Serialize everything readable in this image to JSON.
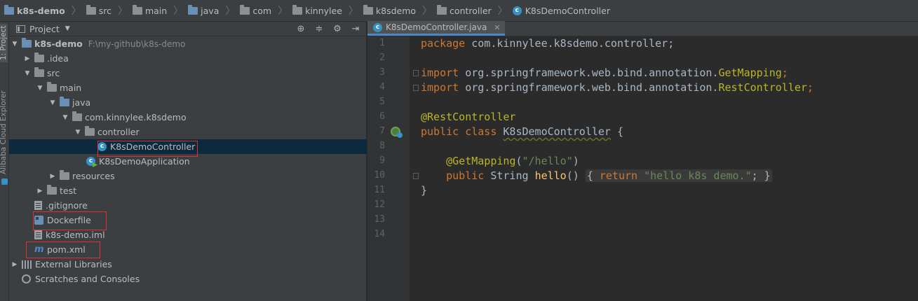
{
  "breadcrumb": [
    {
      "label": "k8s-demo",
      "icon": "project-folder-icon"
    },
    {
      "label": "src",
      "icon": "folder-icon"
    },
    {
      "label": "main",
      "icon": "folder-icon"
    },
    {
      "label": "java",
      "icon": "source-folder-icon"
    },
    {
      "label": "com",
      "icon": "folder-icon"
    },
    {
      "label": "kinnylee",
      "icon": "folder-icon"
    },
    {
      "label": "k8sdemo",
      "icon": "folder-icon"
    },
    {
      "label": "controller",
      "icon": "folder-icon"
    },
    {
      "label": "K8sDemoController",
      "icon": "class-icon"
    }
  ],
  "toolwindows": {
    "project_tab": "1: Project",
    "alibaba_tab": "Alibaba Cloud Explorer"
  },
  "project_panel": {
    "title": "Project",
    "tree": [
      {
        "label": "k8s-demo",
        "path": "F:\\my-github\\k8s-demo",
        "icon": "project-folder-icon",
        "expanded": true
      },
      {
        "label": ".idea",
        "icon": "folder-icon",
        "expanded": false
      },
      {
        "label": "src",
        "icon": "folder-icon",
        "expanded": true
      },
      {
        "label": "main",
        "icon": "folder-icon",
        "expanded": true
      },
      {
        "label": "java",
        "icon": "source-folder-icon",
        "expanded": true
      },
      {
        "label": "com.kinnylee.k8sdemo",
        "icon": "package-icon",
        "expanded": true
      },
      {
        "label": "controller",
        "icon": "package-icon",
        "expanded": true
      },
      {
        "label": "K8sDemoController",
        "icon": "class-icon",
        "selected": true
      },
      {
        "label": "K8sDemoApplication",
        "icon": "spring-app-class-icon"
      },
      {
        "label": "resources",
        "icon": "resources-folder-icon",
        "expanded": false
      },
      {
        "label": "test",
        "icon": "folder-icon",
        "expanded": false
      },
      {
        "label": ".gitignore",
        "icon": "text-file-icon"
      },
      {
        "label": "Dockerfile",
        "icon": "docker-file-icon"
      },
      {
        "label": "k8s-demo.iml",
        "icon": "module-file-icon"
      },
      {
        "label": "pom.xml",
        "icon": "maven-icon"
      },
      {
        "label": "External Libraries",
        "icon": "libraries-icon",
        "expanded": false
      },
      {
        "label": "Scratches and Consoles",
        "icon": "scratches-icon"
      }
    ]
  },
  "editor": {
    "tab_label": "K8sDemoController.java",
    "line_numbers": [
      "1",
      "2",
      "3",
      "4",
      "5",
      "6",
      "7",
      "8",
      "9",
      "10",
      "11",
      "12",
      "13",
      "14"
    ],
    "code": {
      "l1_kw": "package",
      "l1_rest": " com.kinnylee.k8sdemo.controller;",
      "l3_kw": "import",
      "l3_rest": " org.springframework.web.bind.annotation.",
      "l3_ann": "GetMapping",
      "l3_end": ";",
      "l4_kw": "import",
      "l4_rest": " org.springframework.web.bind.annotation.",
      "l4_ann": "RestController",
      "l4_end": ";",
      "l6_ann": "@RestController",
      "l7_kw": "public class",
      "l7_cls": "K8sDemoController",
      "l7_end": " {",
      "l9_ann": "@GetMapping",
      "l9_open": "(",
      "l9_str": "\"/hello\"",
      "l9_close": ")",
      "l10_kw": "public",
      "l10_type": " String ",
      "l10_fn": "hello",
      "l10_paren": "()",
      "l10_open": "{ ",
      "l10_ret": "return",
      "l10_str": "\"hello k8s demo.\"",
      "l10_semi": "; }",
      "l12_close": "}"
    }
  },
  "colors": {
    "highlight_box": "#e03131",
    "keyword": "#cc7832",
    "annotation": "#bbb529",
    "string": "#6a8759",
    "method": "#ffc66d",
    "selection": "#0d293e"
  }
}
